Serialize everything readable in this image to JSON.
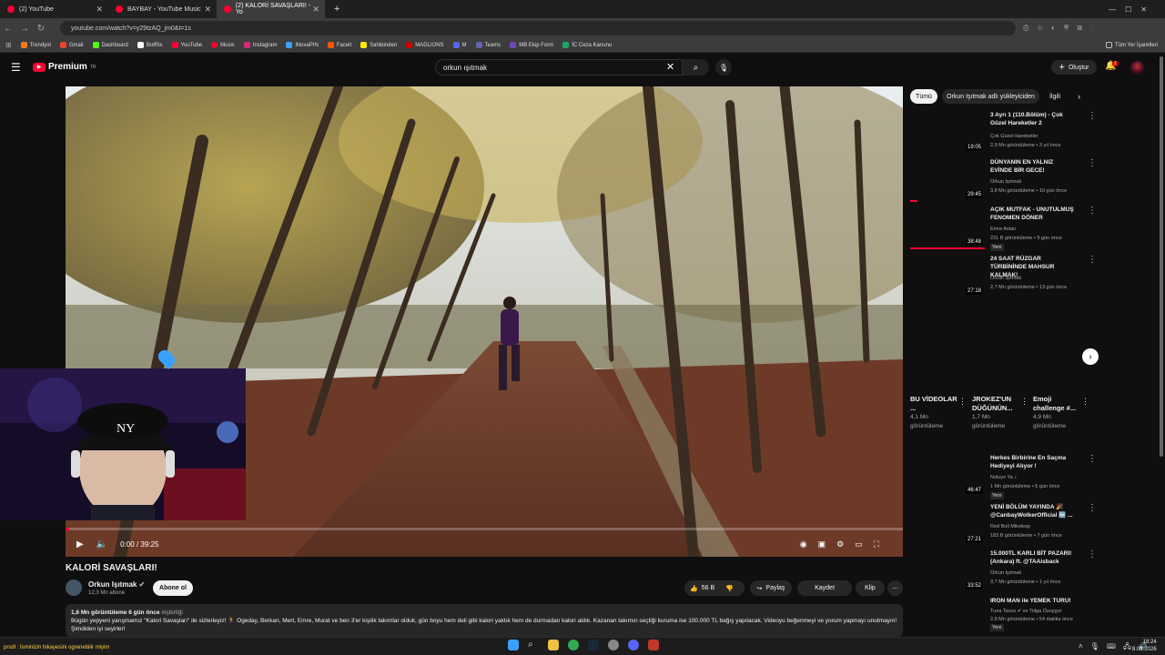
{
  "browser": {
    "tabs": [
      {
        "title": "(2) YouTube"
      },
      {
        "title": "BAYBAY - YouTube Music"
      },
      {
        "title": "(2) KALORİ SAVAŞLARI! - Yo"
      }
    ],
    "new_tab_glyph": "+",
    "url": "youtube.com/watch?v=y29tzAQ_jm0&t=1s",
    "bookmarks": [
      "Trendyol",
      "Gmail",
      "Dashboard",
      "BotRix",
      "YouTube",
      "Music",
      "Instagram",
      "iNovaPIN",
      "Faceit",
      "Sahibinden",
      "MADLIONS",
      "M",
      "Teams",
      "MB Ekip Form",
      "İC Ceza Kanunu"
    ],
    "all_bookmarks": "Tüm Yer İşaretleri"
  },
  "youtube": {
    "logo_text": "Premium",
    "logo_sup": "TR",
    "search_value": "orkun ışıtmak",
    "create_label": "Oluştur",
    "notif_count": "2"
  },
  "player": {
    "time": "0:00 / 39:25",
    "progress": 0.0
  },
  "video": {
    "title": "KALORİ SAVAŞLARI!",
    "channel": "Orkun Işıtmak",
    "subscribers": "12,3 Mn abone",
    "subscribe_label": "Abone ol",
    "likes": "56 B",
    "share_label": "Paylaş",
    "save_label": "Kaydet",
    "clip_label": "Klip",
    "views_date": "1,6 Mn görüntüleme  6 gün önce",
    "hashtag": "#işbirliği",
    "description": "Bügün yepyeni yarışmamız \"Kalori Savaşları\" ile sizlerleyiz! 🏃 Ogeday, Berkan, Mert, Emre, Murat ve ben 3'er kişilik takımlar olduk; gün boyu hem deli gibi kalori yaktık hem de durmadan kalori aldık. Kazanan takımın seçtiği kuruma ise 100.000 TL bağış yapılacak. Videoyu beğenmeyi ve yorum yapmayı unutmayın! Şimdiden iyi seyirler!"
  },
  "chips": [
    "Tümü",
    "Orkun Işıtmak adlı yükleyiciden",
    "İlgili"
  ],
  "recommended": [
    {
      "title": "3 Ayrı 1 (110.Bölüm) - Çok Güzel Hareketler 2",
      "channel": "Çok Güzel Hareketler",
      "meta": "2,9 Mn görüntüleme • 3 yıl önce",
      "duration": "19:05",
      "badge": ""
    },
    {
      "title": "DÜNYANIN EN YALNIZ EVİNDE BİR GECE!",
      "channel": "Orkun Işıtmak",
      "meta": "3,8 Mn görüntüleme • 10 gün önce",
      "duration": "29:45",
      "badge": ""
    },
    {
      "title": "AÇIK MUTFAK - UNUTULMUŞ FENOMEN DÖNER",
      "channel": "Emre Aslan",
      "meta": "231 B görüntüleme • 5 gün önce",
      "duration": "38:48",
      "badge": "Yeni"
    },
    {
      "title": "24 SAAT RÜZGAR TÜRBİNİNDE MAHSUR KALMAK!",
      "channel": "Orkun Işıtmak",
      "meta": "2,7 Mn görüntüleme • 13 gün önce",
      "duration": "27:18",
      "badge": ""
    }
  ],
  "shorts": [
    {
      "title": "BU VİDEOLAR ...",
      "views": "4,1 Mn",
      "views_word": "görüntüleme"
    },
    {
      "title": "JROKEZ'UN DÜĞÜNÜN...",
      "views": "1,7 Mn",
      "views_word": "görüntüleme"
    },
    {
      "title": "Emoji challenge #...",
      "views": "4,9 Mn",
      "views_word": "görüntüleme"
    }
  ],
  "recommended2": [
    {
      "title": "Herkes Birbirine En Saçma Hediyeyi Alıyor !",
      "channel": "Noluyo Ya ♪",
      "meta": "1 Mn görüntüleme • 5 gün önce",
      "duration": "46:47",
      "badge": "Yeni"
    },
    {
      "title": "YENİ BÖLÜM YAYINDA 🎉 @CanbayWolkerOfficial 🆕 ...",
      "channel": "Red Bull Mikstesp",
      "meta": "183 B görüntüleme • 7 gün önce",
      "duration": "27:21",
      "badge": ""
    },
    {
      "title": "15.000TL KARLI BİT PAZARI! (Ankara) ft. @TAAisback",
      "channel": "Orkun Işıtmak",
      "meta": "3,7 Mn görüntüleme • 1 yıl önce",
      "duration": "33:52",
      "badge": ""
    },
    {
      "title": "IRON MAN ile YEMEK TURU!",
      "channel": "Tuna Tavus ✔ ve Tolga Özuygur",
      "meta": "2,8 Mn görüntüleme • 54 dakika önce",
      "duration": "",
      "badge": "Yeni"
    }
  ],
  "taskbar": {
    "stream_title": "prsdl : İsminizin hikayesini ogrenebilir miyim",
    "time": "18:24",
    "date": "8.01.2026"
  }
}
